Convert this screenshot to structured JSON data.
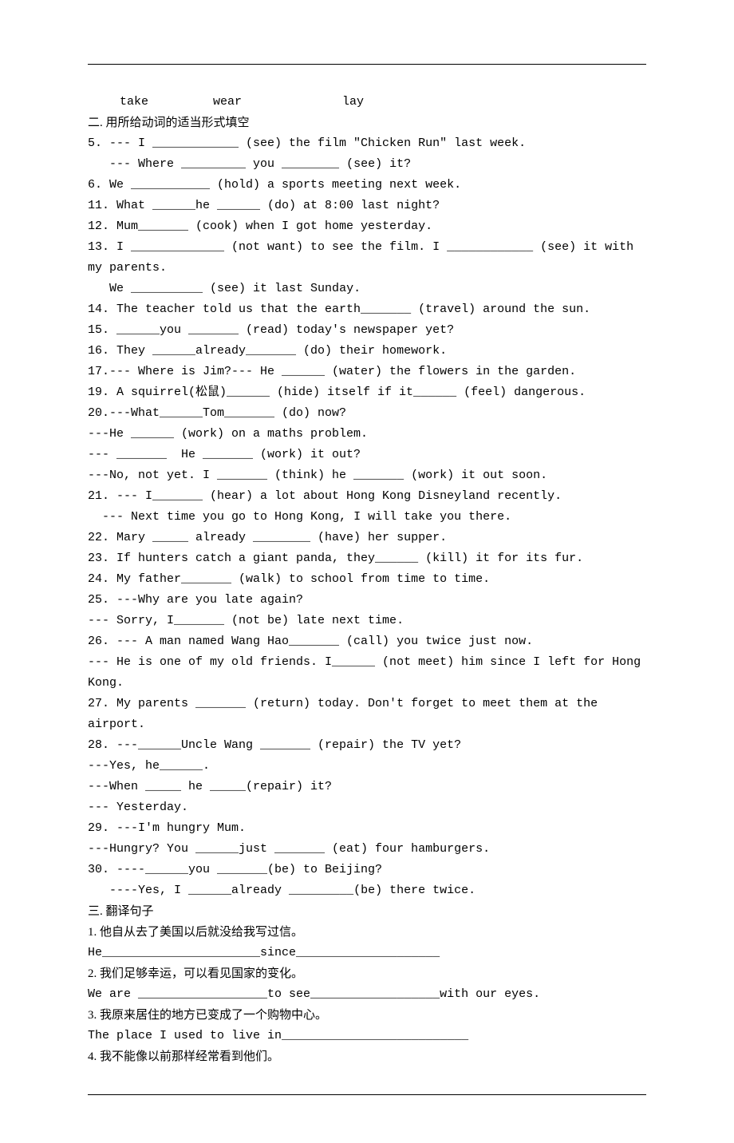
{
  "topRow": "  take         wear              lay",
  "sec2Heading": "二.    用所给动词的适当形式填空",
  "lines": {
    "l5a": "5. --- I ____________ (see) the film \"Chicken Run\" last week.",
    "l5b": "   --- Where _________ you ________ (see) it?",
    "l6": "6. We ___________ (hold) a sports meeting next week.",
    "l11": "11. What ______he ______ (do) at 8:00 last night?",
    "l12": "12. Mum_______ (cook) when I got home yesterday.",
    "l13a": "13. I _____________ (not want) to see the film. I ____________ (see) it with my parents.",
    "l13b": "   We __________ (see) it last Sunday.",
    "l14": "14. The teacher told us that the earth_______ (travel) around the sun.",
    "l15": "15. ______you _______ (read) today's newspaper yet?",
    "l16": "16. They ______already_______ (do) their homework.",
    "l17": "17.--- Where is Jim?--- He ______ (water) the flowers in the garden.",
    "l19": "19. A squirrel(松鼠)______ (hide) itself if it______ (feel) dangerous.",
    "l20a": "20.---What______Tom_______ (do) now?",
    "l20b": "---He ______ (work) on a maths problem.",
    "l20c": "--- _______  He _______ (work) it out?",
    "l20d": "---No, not yet. I _______ (think) he _______ (work) it out soon.",
    "l21a": "21. --- I_______ (hear) a lot about Hong Kong Disneyland recently.",
    "l21b": "  --- Next time you go to Hong Kong, I will take you there.",
    "l22": "22. Mary _____ already ________ (have) her supper.",
    "l23": "23. If hunters catch a giant panda, they______ (kill) it for its fur.",
    "l24": "24. My father_______ (walk) to school from time to time.",
    "l25a": "25. ---Why are you late again?",
    "l25b": "--- Sorry, I_______ (not be) late next time.",
    "l26a": "26. --- A man named Wang Hao_______ (call) you twice just now.",
    "l26b": "--- He is one of my old friends. I______ (not meet) him since I left for Hong Kong.",
    "l27": "27. My parents _______ (return) today. Don't forget to meet them at the airport.",
    "l28a": "28. ---______Uncle Wang _______ (repair) the TV yet?",
    "l28b": "---Yes, he______.",
    "l28c": "---When _____ he _____(repair) it?",
    "l28d": "--- Yesterday.",
    "l29a": "29. ---I'm hungry Mum.",
    "l29b": "---Hungry? You ______just _______ (eat) four hamburgers.",
    "l30a": "30. ----______you _______(be) to Beijing?",
    "l30b": "   ----Yes, I ______already _________(be) there twice."
  },
  "sec3Heading": "三. 翻译句子",
  "translate": {
    "t1q": "1. 他自从去了美国以后就没给我写过信。",
    "t1a": "He______________________since____________________",
    "t2q": "2. 我们足够幸运，可以看见国家的变化。",
    "t2a": "We are __________________to see__________________with our eyes.",
    "t3q": "3. 我原来居住的地方已变成了一个购物中心。",
    "t3a": "The place I used to live in__________________________",
    "t4q": "4. 我不能像以前那样经常看到他们。"
  }
}
